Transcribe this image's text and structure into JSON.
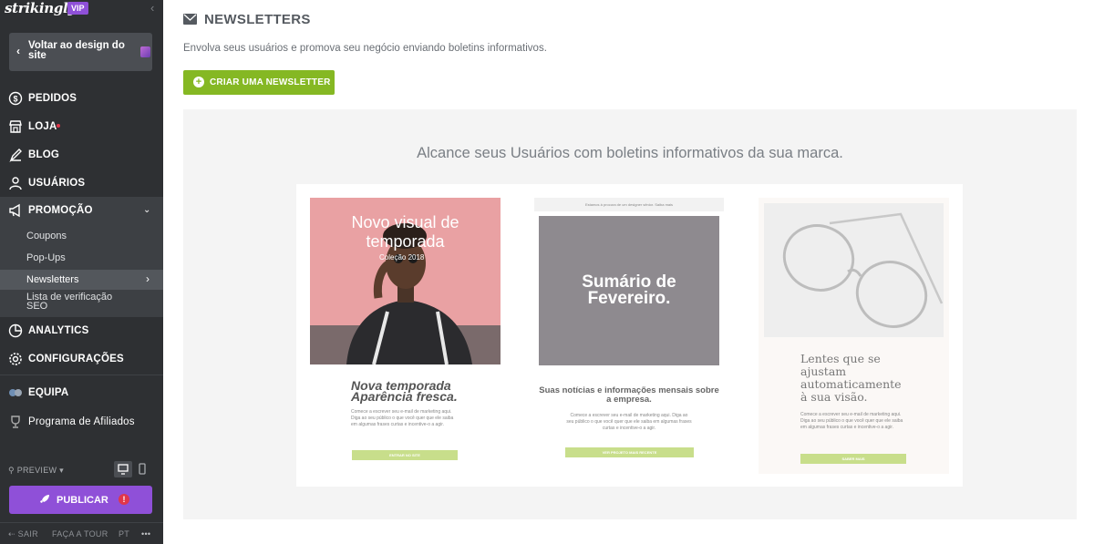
{
  "app": {
    "logo": "strikingly",
    "badge": "VIP"
  },
  "sidebar": {
    "back_label": "Voltar ao design do site",
    "items": [
      {
        "label": "PEDIDOS",
        "icon": "dollar-icon"
      },
      {
        "label": "LOJA",
        "icon": "store-icon"
      },
      {
        "label": "BLOG",
        "icon": "pen-icon"
      },
      {
        "label": "USUÁRIOS",
        "icon": "user-icon"
      },
      {
        "label": "PROMOÇÃO",
        "icon": "megaphone-icon"
      },
      {
        "label": "ANALYTICS",
        "icon": "pie-chart-icon"
      },
      {
        "label": "CONFIGURAÇÕES",
        "icon": "gear-icon"
      },
      {
        "label": "EQUIPA",
        "icon": "team-icon"
      },
      {
        "label": "Programa de Afiliados",
        "icon": "trophy-icon"
      }
    ],
    "promo_sub": [
      "Coupons",
      "Pop-Ups",
      "Newsletters",
      "Lista de verificação SEO"
    ],
    "preview_label": "PREVIEW",
    "publish_label": "PUBLICAR",
    "publish_badge": "!",
    "footer": {
      "exit": "SAIR",
      "tour": "FAÇA A TOUR",
      "lang": "PT",
      "more": "•••"
    }
  },
  "main": {
    "title": "NEWSLETTERS",
    "description": "Envolva seus usuários e promova seu negócio enviando boletins informativos.",
    "create_label": "CRIAR UMA NEWSLETTER",
    "panel_title": "Alcance seus Usuários com boletins informativos da sua marca.",
    "card1": {
      "heading": "Novo visual de temporada",
      "small": "Coleção 2018",
      "title": "Nova temporada Aparência fresca.",
      "body": "Comece a escrever seu e-mail de marketing aqui. Diga ao seu público o que você quer que ele saiba em algumas frases curtas e incentive-o a agir.",
      "button": "ENTRAR NO SITE"
    },
    "card2": {
      "top": "Estamos à procura de um designer sênior. Saiba mais",
      "heading": "Sumário de Fevereiro.",
      "title": "Suas notícias e informações mensais sobre a empresa.",
      "body": "Comece a escrever seu e-mail de marketing aqui. Diga ao seu público o que você quer que ele saiba em algumas frases curtas e incentive-o a agir.",
      "button": "VER PROJETO MAIS RECENTE"
    },
    "card3": {
      "title": "Lentes que se ajustam automaticamente à sua visão.",
      "body": "Comece a escrever seu e-mail de marketing aqui. Diga ao seu público o que você quer que ele saiba em algumas frases curtas e incentive-o a agir.",
      "button": "SABER MAIS"
    }
  },
  "colors": {
    "accent": "#8f50d8",
    "green": "#85b823",
    "sidebar": "#2e3033"
  }
}
